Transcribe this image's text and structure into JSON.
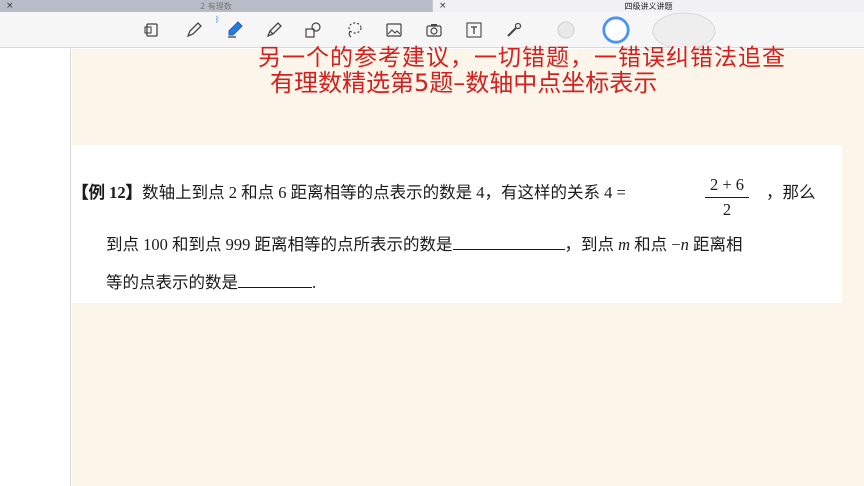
{
  "tabs": [
    {
      "label": "2 有理数",
      "close": "×",
      "active": false
    },
    {
      "label": "四级讲义讲题",
      "close": "×",
      "active": true
    }
  ],
  "toolbar": {
    "tools": [
      "page-icon",
      "pen-icon",
      "eraser-icon",
      "highlighter-icon",
      "shapes-icon",
      "lasso-icon",
      "image-icon",
      "camera-icon",
      "text-icon",
      "laser-pointer-icon",
      "color-swatch-gray",
      "color-swatch-blue-selected",
      "color-swatch-large"
    ],
    "bluetooth": "ᛒ",
    "accent": "#2a7be4"
  },
  "document": {
    "subtitle_partial": "另一个的参考建议，一切错题，一错误纠错法追查",
    "title": "有理数精选第5题–数轴中点坐标表示",
    "question": {
      "tag": "【例  12】",
      "line1": "数轴上到点 2 和点 6 距离相等的点表示的数是 4，有这样的关系 4 =",
      "frac_num": "2 + 6",
      "frac_den": "2",
      "line1_end": "，那么",
      "line2_a": "到点 100 和到点 999 距离相等的点所表示的数是",
      "line2_b": "，到点",
      "var_m": "m",
      "line2_c": " 和点 −",
      "var_n": "n",
      "line2_d": " 距离相",
      "line3_a": "等的点表示的数是",
      "line3_b": "."
    },
    "title_color": "#d71e1e"
  }
}
